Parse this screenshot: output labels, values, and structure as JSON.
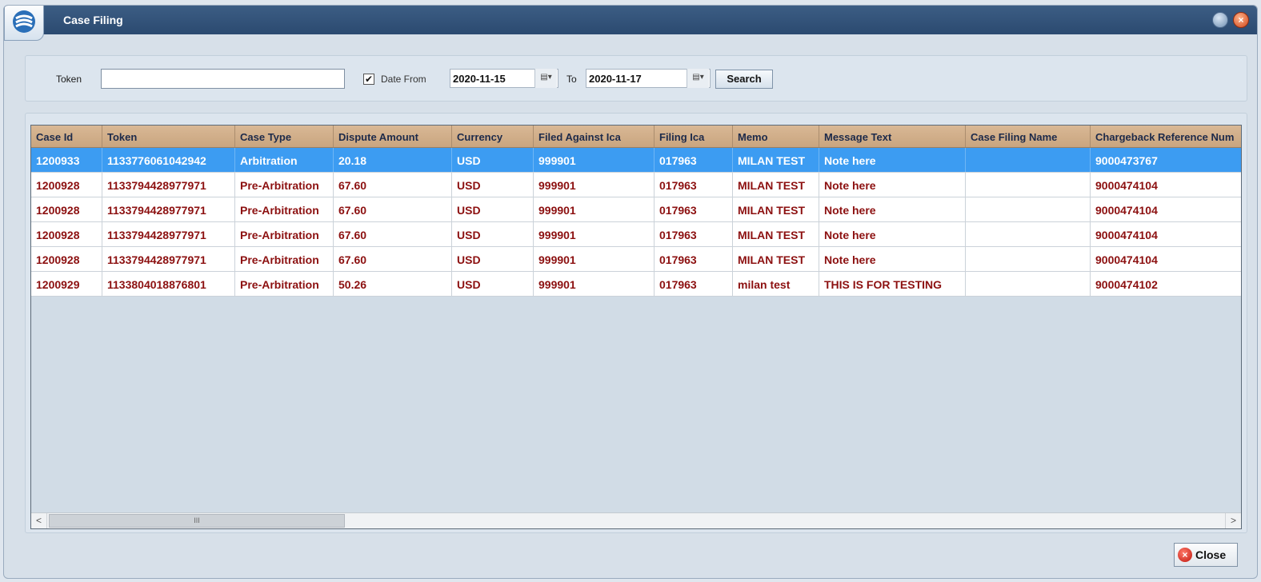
{
  "window": {
    "title": "Case Filing"
  },
  "filters": {
    "token_label": "Token",
    "token_value": "",
    "date_from_checked": true,
    "date_from_label": "Date From",
    "date_from": "2020-11-15",
    "to_label": "To",
    "date_to": "2020-11-17",
    "search_label": "Search"
  },
  "grid": {
    "columns": [
      "Case Id",
      "Token",
      "Case Type",
      "Dispute Amount",
      "Currency",
      "Filed Against Ica",
      "Filing Ica",
      "Memo",
      "Message Text",
      "Case Filing Name",
      "Chargeback Reference Num"
    ],
    "rows": [
      [
        "1200933",
        "1133776061042942",
        "Arbitration",
        "20.18",
        "USD",
        "999901",
        "017963",
        "MILAN TEST",
        "Note here",
        "",
        "9000473767"
      ],
      [
        "1200928",
        "1133794428977971",
        "Pre-Arbitration",
        "67.60",
        "USD",
        "999901",
        "017963",
        "MILAN TEST",
        "Note here",
        "",
        "9000474104"
      ],
      [
        "1200928",
        "1133794428977971",
        "Pre-Arbitration",
        "67.60",
        "USD",
        "999901",
        "017963",
        "MILAN TEST",
        "Note here",
        "",
        "9000474104"
      ],
      [
        "1200928",
        "1133794428977971",
        "Pre-Arbitration",
        "67.60",
        "USD",
        "999901",
        "017963",
        "MILAN TEST",
        "Note here",
        "",
        "9000474104"
      ],
      [
        "1200928",
        "1133794428977971",
        "Pre-Arbitration",
        "67.60",
        "USD",
        "999901",
        "017963",
        "MILAN TEST",
        "Note here",
        "",
        "9000474104"
      ],
      [
        "1200929",
        "1133804018876801",
        "Pre-Arbitration",
        "50.26",
        "USD",
        "999901",
        "017963",
        "milan test",
        "THIS IS FOR TESTING",
        "",
        "9000474102"
      ]
    ],
    "selected_row": 0,
    "scroll_thumb_glyph": "III"
  },
  "footer": {
    "close_label": "Close"
  },
  "colors": {
    "title_bar": "#2b4a70",
    "header": "#c9a57f",
    "row_text": "#8c1010",
    "selection": "#3c9cf2"
  }
}
